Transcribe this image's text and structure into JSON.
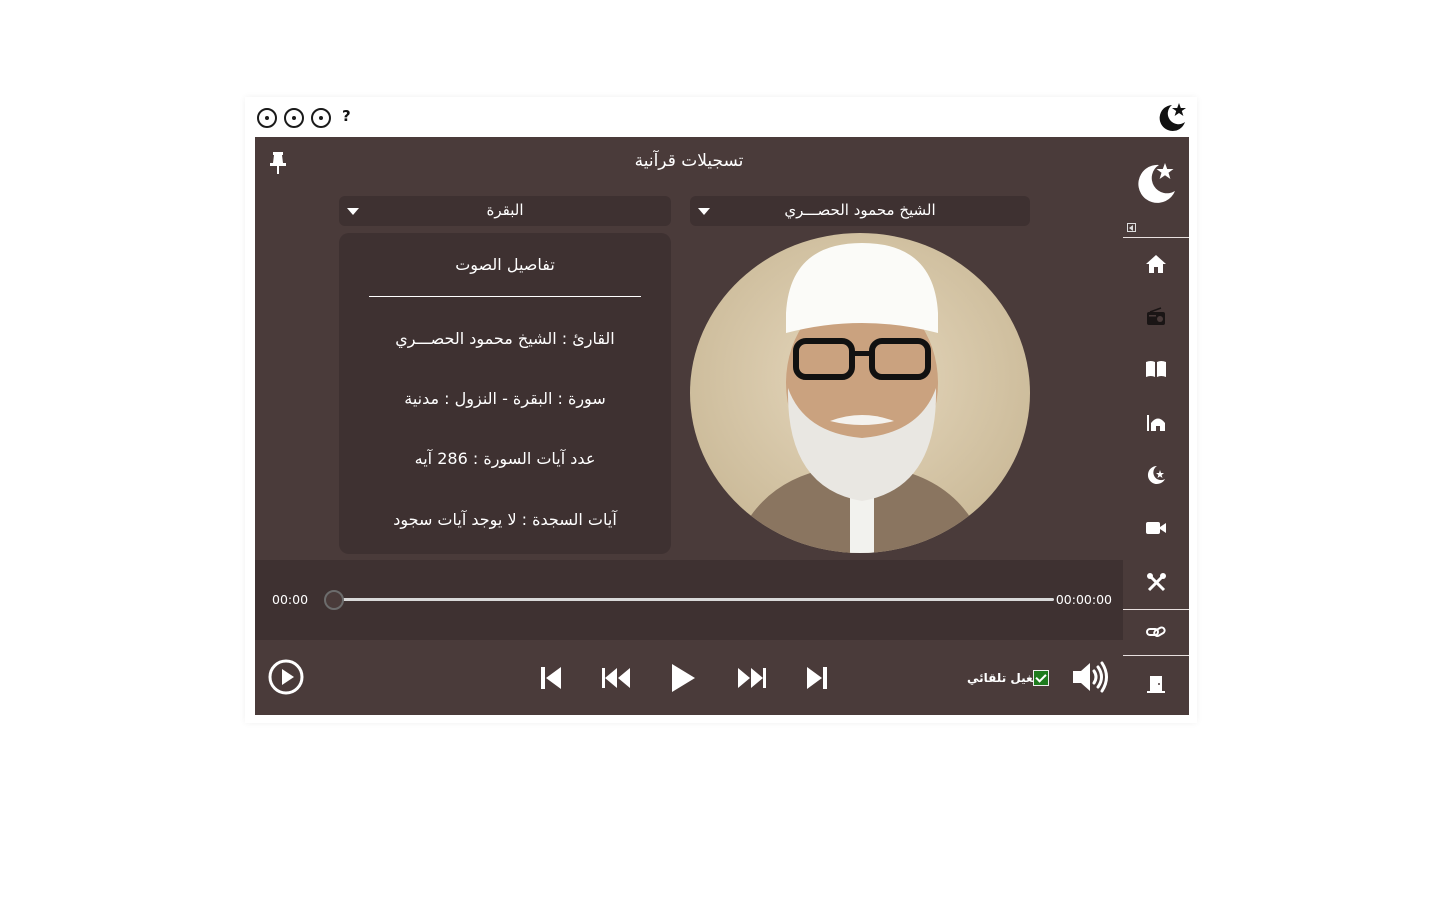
{
  "titlebar": {
    "help_label": "?"
  },
  "header": {
    "title": "تسجيلات قرآنية"
  },
  "selectors": {
    "reciter": "الشيخ محمود الحصـــري",
    "surah": "البقرة"
  },
  "details": {
    "heading": "تفاصيل الصوت",
    "reciter_line": "القارئ : الشيخ محمود الحصـــري",
    "surah_line": "سورة  :  البقرة  -  النزول  :  مدنية",
    "verses_line": "عدد آيات السورة :  286  آيه",
    "sajda_line": "آيات السجدة  :  لا يوجد آيات سجود"
  },
  "player": {
    "elapsed": "00:00",
    "duration": "00:00:00",
    "progress": 0,
    "autoplay_label": "تشغيل تلقائي",
    "autoplay_checked": true
  },
  "sidebar": {
    "items": [
      "home-icon",
      "radio-icon",
      "book-open-icon",
      "mosque-icon",
      "crescent-star-icon",
      "video-camera-icon",
      "tools-icon",
      "link-icon",
      "exit-door-icon"
    ]
  },
  "colors": {
    "panel": "#4a3b3a",
    "panel_dark": "#3e3131",
    "checkbox": "#1e7b1e"
  }
}
